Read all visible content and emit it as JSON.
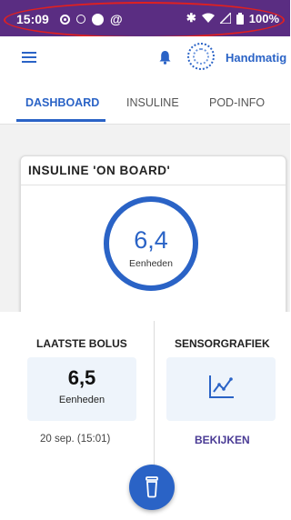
{
  "status_bar": {
    "time": "15:09",
    "battery": "100%",
    "icons": [
      "circle-dot-icon",
      "circle-dot-icon",
      "circle-icon",
      "at-sign-icon",
      "bluetooth-icon",
      "wifi-icon",
      "signal-icon",
      "battery-icon"
    ]
  },
  "header": {
    "menu_icon": "hamburger-icon",
    "bell_icon": "bell-icon",
    "pod_icon": "pod-status-icon",
    "mode_label": "Handmatig"
  },
  "tabs": [
    {
      "label": "DASHBOARD",
      "active": true
    },
    {
      "label": "INSULINE",
      "active": false
    },
    {
      "label": "POD-INFO",
      "active": false
    }
  ],
  "iob_card": {
    "title": "INSULINE 'ON BOARD'",
    "value": "6,4",
    "unit": "Eenheden"
  },
  "pager": {
    "count": 3,
    "active_index": 0
  },
  "last_bolus": {
    "title": "LAATSTE BOLUS",
    "value": "6,5",
    "unit": "Eenheden",
    "time": "20 sep. (15:01)"
  },
  "sensor": {
    "title": "SENSORGRAFIEK",
    "icon": "line-chart-icon",
    "link_label": "BEKIJKEN"
  },
  "fab": {
    "icon": "bolus-icon"
  },
  "colors": {
    "status_bar": "#5a2d82",
    "accent": "#2a63c6",
    "link": "#4a3b95",
    "highlight": "#e02020"
  }
}
